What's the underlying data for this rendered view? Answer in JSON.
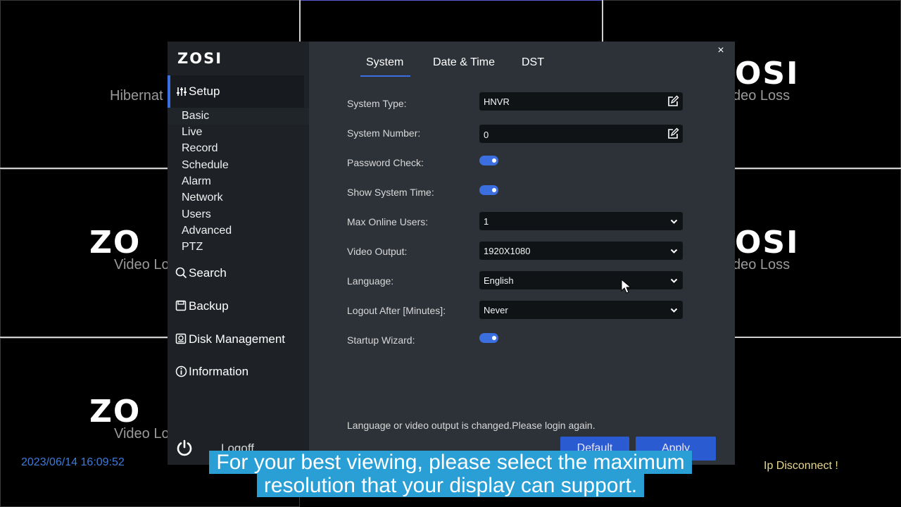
{
  "background": {
    "cells": [
      {
        "logo": "",
        "sub": "Hibernat"
      },
      {
        "logo": "",
        "sub": ""
      },
      {
        "logo": "OSI",
        "sub": "deo Loss"
      },
      {
        "logo": "ZO",
        "sub": "Video Lo"
      },
      {
        "logo": "OSI",
        "sub": "deo Loss"
      },
      {
        "logo": "ZO",
        "sub": "Video Lo"
      }
    ],
    "timestamp": "2023/06/14 16:09:52",
    "ip_status": "Ip Disconnect !"
  },
  "dialog": {
    "brand": "ZOSI",
    "close_symbol": "×",
    "sidebar": {
      "setup_label": "Setup",
      "sub_items": [
        "Basic",
        "Live",
        "Record",
        "Schedule",
        "Alarm",
        "Network",
        "Users",
        "Advanced",
        "PTZ"
      ],
      "search_label": "Search",
      "backup_label": "Backup",
      "disk_label": "Disk Management",
      "info_label": "Information",
      "logoff_label": "Logoff"
    },
    "tabs": [
      "System",
      "Date & Time",
      "DST"
    ],
    "active_tab": "System",
    "form": {
      "system_type": {
        "label": "System Type:",
        "value": "HNVR"
      },
      "system_number": {
        "label": "System Number:",
        "value": "0"
      },
      "password_check": {
        "label": "Password Check:",
        "on": true
      },
      "show_system_time": {
        "label": "Show System Time:",
        "on": true
      },
      "max_online_users": {
        "label": "Max Online Users:",
        "value": "1"
      },
      "video_output": {
        "label": "Video Output:",
        "value": "1920X1080"
      },
      "language": {
        "label": "Language:",
        "value": "English"
      },
      "logout_after": {
        "label": "Logout After [Minutes]:",
        "value": "Never"
      },
      "startup_wizard": {
        "label": "Startup Wizard:",
        "on": true
      }
    },
    "notice": "Language or video output is changed.Please login again.",
    "default_button": "Default",
    "apply_button": "Apply"
  },
  "subtitle": {
    "line1": "For your best viewing, please select the maximum",
    "line2": "resolution that your display can support."
  },
  "colors": {
    "accent": "#3b6fe0",
    "dialog_bg": "#2d3238",
    "sidebar_bg": "#1e2227",
    "subtitle_bg": "#2a9fd6"
  }
}
